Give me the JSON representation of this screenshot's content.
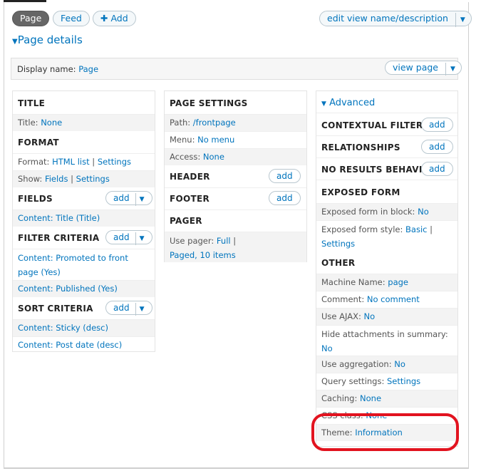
{
  "tabs": [
    {
      "label": "Page"
    },
    {
      "label": "Feed"
    },
    {
      "label": "Add",
      "icon": "plus-icon"
    }
  ],
  "edit_view_button": "edit view name/description",
  "section_title": "Page details",
  "display_name": {
    "label": "Display name:",
    "value": "Page"
  },
  "view_page_button": "view page",
  "col1": {
    "title_header": "TITLE",
    "title_row": {
      "label": "Title:",
      "value": "None"
    },
    "format_header": "FORMAT",
    "format_row": {
      "label": "Format:",
      "value": "HTML list",
      "sep": "|",
      "settings": "Settings"
    },
    "show_row": {
      "label": "Show:",
      "value": "Fields",
      "sep": "|",
      "settings": "Settings"
    },
    "fields_header": "FIELDS",
    "fields_add": "add",
    "fields_items": [
      "Content: Title (Title)"
    ],
    "filter_header": "FILTER CRITERIA",
    "filter_add": "add",
    "filter_items": [
      "Content: Promoted to front page (Yes)",
      "Content: Published (Yes)"
    ],
    "sort_header": "SORT CRITERIA",
    "sort_add": "add",
    "sort_items": [
      "Content: Sticky (desc)",
      "Content: Post date (desc)"
    ]
  },
  "col2": {
    "settings_header": "PAGE SETTINGS",
    "path_row": {
      "label": "Path:",
      "value": "/frontpage"
    },
    "menu_row": {
      "label": "Menu:",
      "value": "No menu"
    },
    "access_row": {
      "label": "Access:",
      "value": "None"
    },
    "header_header": "HEADER",
    "header_add": "add",
    "footer_header": "FOOTER",
    "footer_add": "add",
    "pager_header": "PAGER",
    "pager_row": {
      "label": "Use pager:",
      "value": "Full",
      "sep": "|",
      "value2": "Paged, 10 items"
    }
  },
  "col3": {
    "advanced_title": "Advanced",
    "contextual_header": "CONTEXTUAL FILTERS",
    "contextual_add": "add",
    "relationships_header": "RELATIONSHIPS",
    "relationships_add": "add",
    "noresults_header": "NO RESULTS BEHAVIOR",
    "noresults_add": "add",
    "exposed_header": "EXPOSED FORM",
    "exposed_block_row": {
      "label": "Exposed form in block:",
      "value": "No"
    },
    "exposed_style_row": {
      "label": "Exposed form style:",
      "value": "Basic",
      "sep": "|",
      "settings": "Settings"
    },
    "other_header": "OTHER",
    "machine_row": {
      "label": "Machine Name:",
      "value": "page"
    },
    "comment_row": {
      "label": "Comment:",
      "value": "No comment"
    },
    "ajax_row": {
      "label": "Use AJAX:",
      "value": "No"
    },
    "attach_row": {
      "label": "Hide attachments in summary:",
      "value": "No"
    },
    "aggregation_row": {
      "label": "Use aggregation:",
      "value": "No"
    },
    "query_row": {
      "label": "Query settings:",
      "value": "Settings"
    },
    "caching_row": {
      "label": "Caching:",
      "value": "None"
    },
    "css_row": {
      "label": "CSS class:",
      "value": "None"
    },
    "theme_row": {
      "label": "Theme:",
      "value": "Information"
    }
  },
  "colors": {
    "link": "#0074bd",
    "highlight_ring": "#e2131f",
    "active_tab": "#666666"
  }
}
